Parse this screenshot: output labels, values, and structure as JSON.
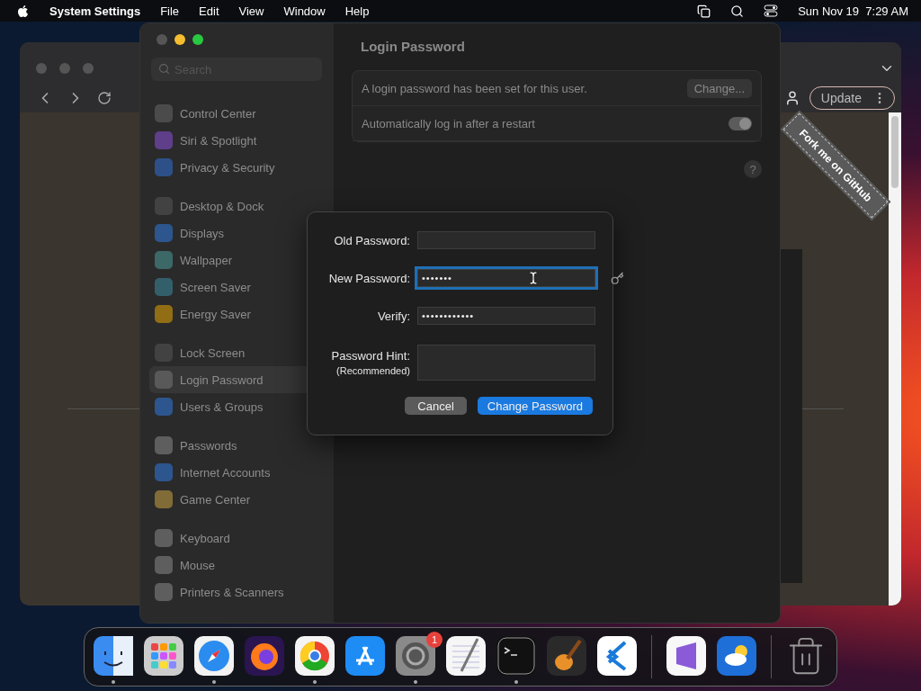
{
  "menubar": {
    "app_name": "System Settings",
    "menus": [
      "File",
      "Edit",
      "View",
      "Window",
      "Help"
    ],
    "clock": "Sun Nov 19  7:29 AM"
  },
  "browser": {
    "update_button": "Update",
    "ribbon": "Fork me on GitHub"
  },
  "settings": {
    "search": {
      "placeholder": "Search"
    },
    "sidebar": {
      "groups": [
        [
          {
            "label": "Control Center",
            "selected": false
          },
          {
            "label": "Siri & Spotlight",
            "selected": false
          },
          {
            "label": "Privacy & Security",
            "selected": false
          }
        ],
        [
          {
            "label": "Desktop & Dock",
            "selected": false
          },
          {
            "label": "Displays",
            "selected": false
          },
          {
            "label": "Wallpaper",
            "selected": false
          },
          {
            "label": "Screen Saver",
            "selected": false
          },
          {
            "label": "Energy Saver",
            "selected": false
          }
        ],
        [
          {
            "label": "Lock Screen",
            "selected": false
          },
          {
            "label": "Login Password",
            "selected": true
          },
          {
            "label": "Users & Groups",
            "selected": false
          }
        ],
        [
          {
            "label": "Passwords",
            "selected": false
          },
          {
            "label": "Internet Accounts",
            "selected": false
          },
          {
            "label": "Game Center",
            "selected": false
          }
        ],
        [
          {
            "label": "Keyboard",
            "selected": false
          },
          {
            "label": "Mouse",
            "selected": false
          },
          {
            "label": "Printers & Scanners",
            "selected": false
          }
        ]
      ]
    },
    "title": "Login Password",
    "rows": [
      {
        "kind": "button",
        "text": "A login password has been set for this user.",
        "button": "Change..."
      },
      {
        "kind": "toggle",
        "text": "Automatically log in after a restart",
        "on": true
      }
    ],
    "help_button": "?"
  },
  "dialog": {
    "fields": [
      {
        "kind": "line",
        "label": "Old Password:",
        "focused": false
      },
      {
        "kind": "line",
        "label": "New Password:",
        "value": "•••••••",
        "focused": true
      },
      {
        "kind": "line",
        "label": "Verify:",
        "value": "••••••••••••",
        "focused": false
      },
      {
        "kind": "area",
        "label": "Password Hint:",
        "sublabel": "(Recommended)",
        "focused": false
      }
    ],
    "buttons": [
      {
        "label": "Cancel",
        "default": false
      },
      {
        "label": "Change Password",
        "default": true
      }
    ]
  },
  "dock": {
    "items": [
      {
        "kind": "app",
        "running": true
      },
      {
        "kind": "app",
        "running": false
      },
      {
        "kind": "app",
        "running": true
      },
      {
        "kind": "app",
        "running": false
      },
      {
        "kind": "app",
        "running": true
      },
      {
        "kind": "app",
        "running": false
      },
      {
        "kind": "app",
        "running": true,
        "badge": "1"
      },
      {
        "kind": "app",
        "running": false
      },
      {
        "kind": "app",
        "running": true
      },
      {
        "kind": "app",
        "running": false
      },
      {
        "kind": "app",
        "running": false
      },
      {
        "kind": "separator"
      },
      {
        "kind": "app",
        "running": false
      },
      {
        "kind": "app",
        "running": false
      },
      {
        "kind": "separator"
      },
      {
        "kind": "app",
        "running": false
      }
    ]
  }
}
